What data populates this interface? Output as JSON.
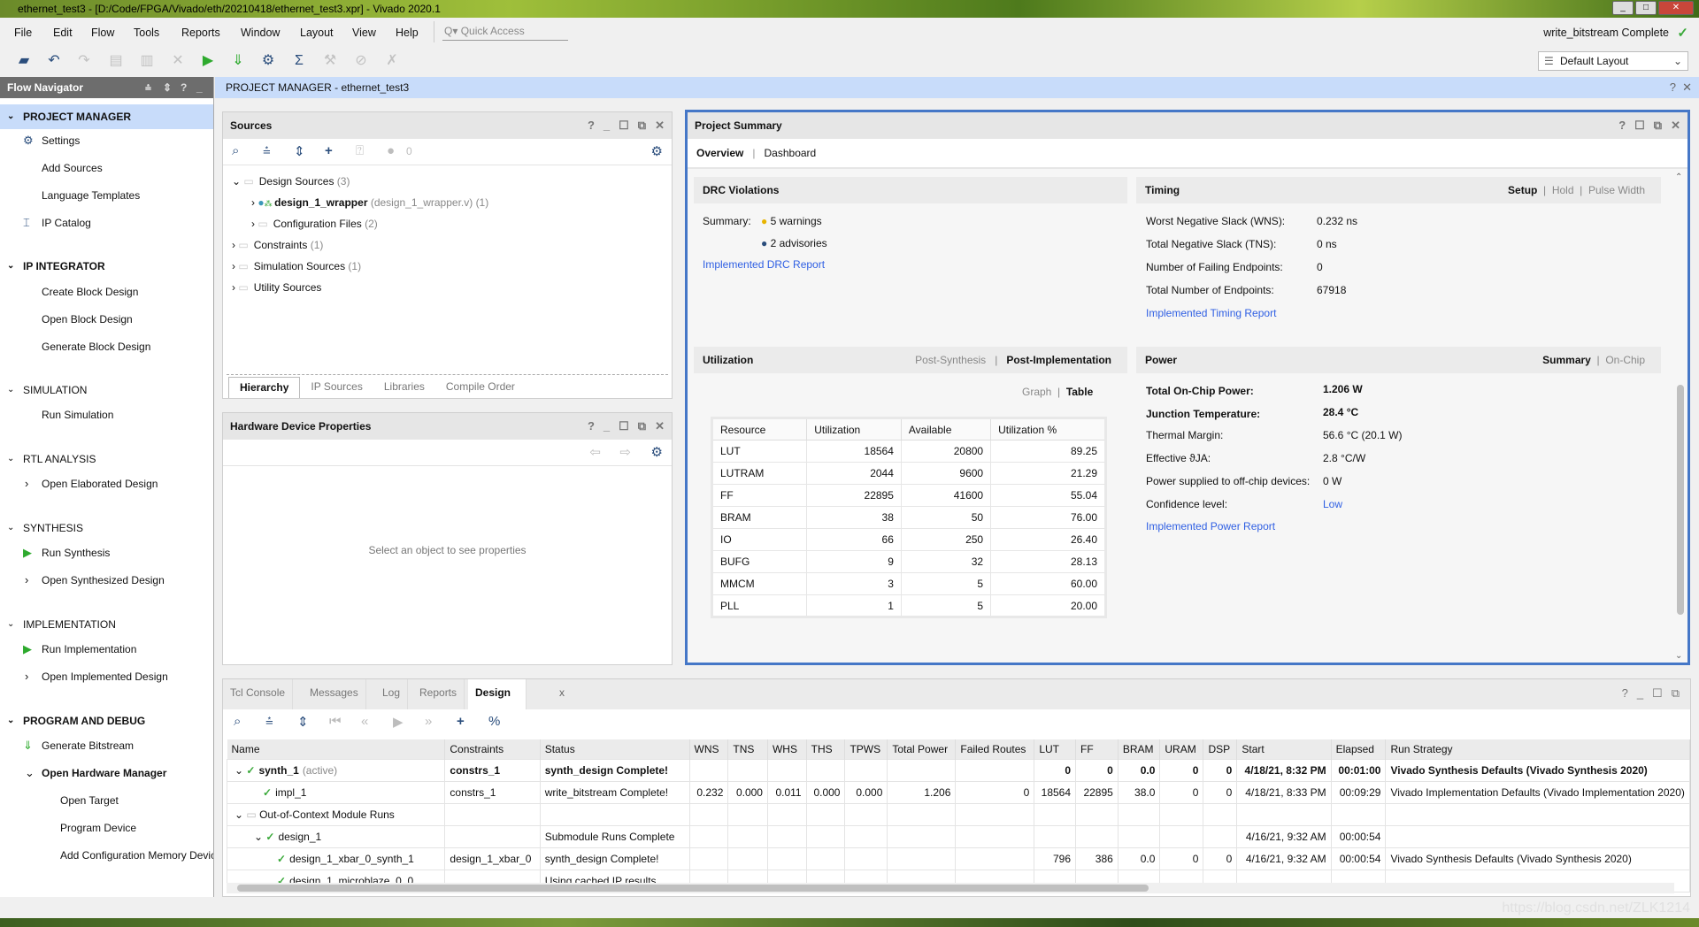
{
  "window": {
    "title": "ethernet_test3 - [D:/Code/FPGA/Vivado/eth/20210418/ethernet_test3.xpr] - Vivado 2020.1"
  },
  "menu": [
    "File",
    "Edit",
    "Flow",
    "Tools",
    "Reports",
    "Window",
    "Layout",
    "View",
    "Help"
  ],
  "quick_access": {
    "placeholder": "Quick Access"
  },
  "run_status": "write_bitstream Complete",
  "layout_select": "Default Layout",
  "toolbar_icons": [
    "open-project",
    "undo",
    "redo",
    "copy",
    "paste",
    "delete",
    "run",
    "generate-bitstream",
    "settings",
    "sigma-report",
    "auto-connect",
    "tool-x",
    "cancel"
  ],
  "flow_nav": {
    "title": "Flow Navigator",
    "sections": [
      {
        "label": "PROJECT MANAGER",
        "items": [
          "Settings",
          "Add Sources",
          "Language Templates",
          "IP Catalog"
        ]
      },
      {
        "label": "IP INTEGRATOR",
        "items": [
          "Create Block Design",
          "Open Block Design",
          "Generate Block Design"
        ]
      },
      {
        "label": "SIMULATION",
        "items": [
          "Run Simulation"
        ]
      },
      {
        "label": "RTL ANALYSIS",
        "items": [
          "Open Elaborated Design"
        ]
      },
      {
        "label": "SYNTHESIS",
        "items": [
          "Run Synthesis",
          "Open Synthesized Design"
        ]
      },
      {
        "label": "IMPLEMENTATION",
        "items": [
          "Run Implementation",
          "Open Implemented Design"
        ]
      },
      {
        "label": "PROGRAM AND DEBUG",
        "items": [
          "Generate Bitstream",
          "Open Hardware Manager",
          "Open Target",
          "Program Device",
          "Add Configuration Memory Device"
        ]
      }
    ]
  },
  "pm_header": "PROJECT MANAGER - ethernet_test3",
  "sources": {
    "title": "Sources",
    "badge_count": "0",
    "tree": [
      {
        "label": "Design Sources",
        "count": "(3)"
      },
      {
        "label": "design_1_wrapper",
        "detail": "(design_1_wrapper.v) (1)"
      },
      {
        "label": "Configuration Files",
        "count": "(2)"
      },
      {
        "label": "Constraints",
        "count": "(1)"
      },
      {
        "label": "Simulation Sources",
        "count": "(1)"
      },
      {
        "label": "Utility Sources",
        "count": ""
      }
    ],
    "tabs": [
      "Hierarchy",
      "IP Sources",
      "Libraries",
      "Compile Order"
    ]
  },
  "hw_props": {
    "title": "Hardware Device Properties",
    "empty": "Select an object to see properties"
  },
  "summary": {
    "title": "Project Summary",
    "tabs": [
      "Overview",
      "Dashboard"
    ],
    "drc": {
      "title": "DRC Violations",
      "summary_label": "Summary:",
      "warnings": "5 warnings",
      "advisories": "2 advisories",
      "link": "Implemented DRC Report"
    },
    "timing": {
      "title": "Timing",
      "opts": [
        "Setup",
        "Hold",
        "Pulse Width"
      ],
      "rows": [
        [
          "Worst Negative Slack (WNS):",
          "0.232 ns"
        ],
        [
          "Total Negative Slack (TNS):",
          "0 ns"
        ],
        [
          "Number of Failing Endpoints:",
          "0"
        ],
        [
          "Total Number of Endpoints:",
          "67918"
        ]
      ],
      "link": "Implemented Timing Report"
    },
    "utilization": {
      "title": "Utilization",
      "opts": [
        "Post-Synthesis",
        "Post-Implementation"
      ],
      "views": [
        "Graph",
        "Table"
      ],
      "headers": [
        "Resource",
        "Utilization",
        "Available",
        "Utilization %"
      ],
      "rows": [
        [
          "LUT",
          "18564",
          "20800",
          "89.25"
        ],
        [
          "LUTRAM",
          "2044",
          "9600",
          "21.29"
        ],
        [
          "FF",
          "22895",
          "41600",
          "55.04"
        ],
        [
          "BRAM",
          "38",
          "50",
          "76.00"
        ],
        [
          "IO",
          "66",
          "250",
          "26.40"
        ],
        [
          "BUFG",
          "9",
          "32",
          "28.13"
        ],
        [
          "MMCM",
          "3",
          "5",
          "60.00"
        ],
        [
          "PLL",
          "1",
          "5",
          "20.00"
        ]
      ]
    },
    "power": {
      "title": "Power",
      "opts": [
        "Summary",
        "On-Chip"
      ],
      "rows": [
        [
          "Total On-Chip Power:",
          "1.206 W"
        ],
        [
          "Junction Temperature:",
          "28.4 °C"
        ],
        [
          "Thermal Margin:",
          "56.6 °C (20.1 W)"
        ],
        [
          "Effective ϑJA:",
          "2.8 °C/W"
        ],
        [
          "Power supplied to off-chip devices:",
          "0 W"
        ],
        [
          "Confidence level:",
          "Low"
        ]
      ],
      "link": "Implemented Power Report"
    }
  },
  "bottom": {
    "tabs": [
      "Tcl Console",
      "Messages",
      "Log",
      "Reports",
      "Design Runs"
    ],
    "columns": [
      "Name",
      "Constraints",
      "Status",
      "WNS",
      "TNS",
      "WHS",
      "THS",
      "TPWS",
      "Total Power",
      "Failed Routes",
      "LUT",
      "FF",
      "BRAM",
      "URAM",
      "DSP",
      "Start",
      "Elapsed",
      "Run Strategy"
    ],
    "rows": [
      [
        "synth_1",
        "constrs_1",
        "synth_design Complete!",
        "",
        "",
        "",
        "",
        "",
        "",
        "",
        "0",
        "0",
        "0.0",
        "0",
        "0",
        "4/18/21, 8:32 PM",
        "00:01:00",
        "Vivado Synthesis Defaults (Vivado Synthesis 2020)"
      ],
      [
        "impl_1",
        "constrs_1",
        "write_bitstream Complete!",
        "0.232",
        "0.000",
        "0.011",
        "0.000",
        "0.000",
        "1.206",
        "0",
        "18564",
        "22895",
        "38.0",
        "0",
        "0",
        "4/18/21, 8:33 PM",
        "00:09:29",
        "Vivado Implementation Defaults (Vivado Implementation 2020)"
      ],
      [
        "Out-of-Context Module Runs",
        "",
        "",
        "",
        "",
        "",
        "",
        "",
        "",
        "",
        "",
        "",
        "",
        "",
        "",
        "",
        "",
        ""
      ],
      [
        "design_1",
        "",
        "Submodule Runs Complete",
        "",
        "",
        "",
        "",
        "",
        "",
        "",
        "",
        "",
        "",
        "",
        "",
        "4/16/21, 9:32 AM",
        "00:00:54",
        ""
      ],
      [
        "design_1_xbar_0_synth_1",
        "design_1_xbar_0",
        "synth_design Complete!",
        "",
        "",
        "",
        "",
        "",
        "",
        "",
        "796",
        "386",
        "0.0",
        "0",
        "0",
        "4/16/21, 9:32 AM",
        "00:00:54",
        "Vivado Synthesis Defaults (Vivado Synthesis 2020)"
      ],
      [
        "design_1_microblaze_0_0",
        "",
        "Using cached IP results",
        "",
        "",
        "",
        "",
        "",
        "",
        "",
        "",
        "",
        "",
        "",
        "",
        "",
        "",
        ""
      ]
    ],
    "active_suffix": "(active)"
  },
  "watermark": "https://blog.csdn.net/ZLK1214",
  "colors": {
    "accent": "#4577c7",
    "link": "#2f5fe3",
    "success": "#3aa93a",
    "nav_active": "#c8dcfa"
  }
}
